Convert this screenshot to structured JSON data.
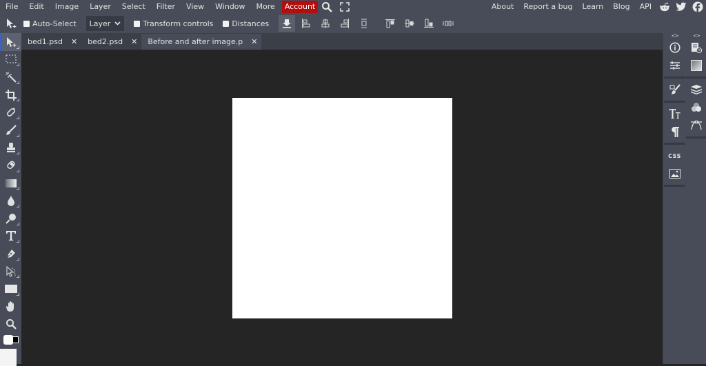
{
  "menubar": {
    "items": [
      "File",
      "Edit",
      "Image",
      "Layer",
      "Select",
      "Filter",
      "View",
      "Window",
      "More"
    ],
    "account_label": "Account",
    "icons": [
      "search-icon",
      "fullscreen-icon"
    ],
    "right_links": [
      "About",
      "Report a bug",
      "Learn",
      "Blog",
      "API"
    ],
    "social_icons": [
      "reddit-icon",
      "twitter-icon",
      "facebook-icon"
    ],
    "account_color": "#b40d0d"
  },
  "options": {
    "auto_select_label": "Auto-Select",
    "auto_select_checked": false,
    "layer_select_value": "Layer",
    "transform_label": "Transform controls",
    "transform_checked": false,
    "distances_label": "Distances",
    "distances_checked": false,
    "buttons": [
      "download-icon",
      "align-left-icon",
      "align-center-icon",
      "align-right-icon",
      "distribute-horizontal-icon",
      "align-top-icon",
      "align-middle-icon",
      "align-bottom-icon",
      "distribute-vertical-icon"
    ]
  },
  "tabs": [
    {
      "label": "bed1.psd",
      "active": false
    },
    {
      "label": "bed2.psd",
      "active": false
    },
    {
      "label": "Before and after image.p",
      "active": true
    }
  ],
  "tools": [
    "move-tool",
    "marquee-tool",
    "magic-wand-tool",
    "crop-tool",
    "healing-tool",
    "brush-tool",
    "clone-stamp-tool",
    "eraser-tool",
    "gradient-tool",
    "blur-tool",
    "dodge-tool",
    "type-tool",
    "pen-tool",
    "path-select-tool",
    "shape-tool",
    "hand-tool",
    "zoom-tool"
  ],
  "colors": {
    "foreground": "#ffffff",
    "background": "#000000"
  },
  "right_panel": {
    "col1": [
      "info-icon",
      "adjustments-icon",
      "brush-settings-icon",
      "character-icon",
      "paragraph-icon",
      "css-icon",
      "image-icon"
    ],
    "col2": [
      "history-icon",
      "swatches-icon",
      "layers-icon",
      "channels-icon",
      "paths-icon"
    ],
    "css_label": "CSS",
    "collapse_glyph": "<>"
  }
}
